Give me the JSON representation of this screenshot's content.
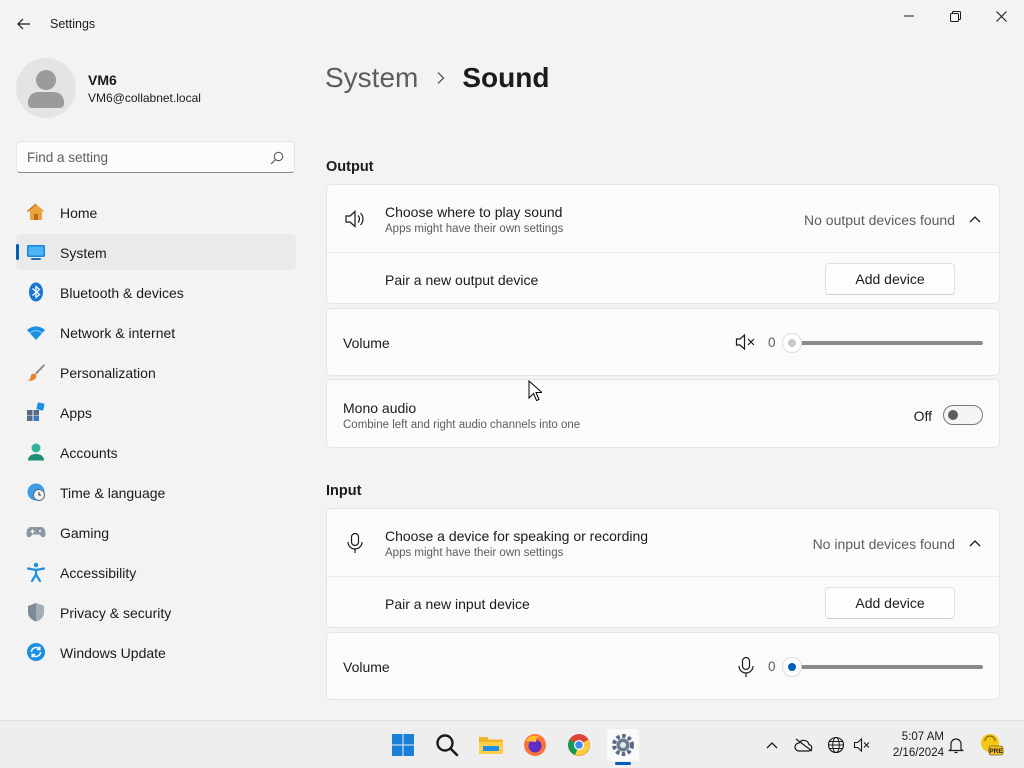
{
  "window": {
    "title": "Settings"
  },
  "profile": {
    "name": "VM6",
    "email": "VM6@collabnet.local"
  },
  "search": {
    "placeholder": "Find a setting"
  },
  "nav": {
    "items": [
      {
        "label": "Home",
        "icon": "home-icon"
      },
      {
        "label": "System",
        "icon": "system-icon",
        "active": true
      },
      {
        "label": "Bluetooth & devices",
        "icon": "bluetooth-icon"
      },
      {
        "label": "Network & internet",
        "icon": "wifi-icon"
      },
      {
        "label": "Personalization",
        "icon": "brush-icon"
      },
      {
        "label": "Apps",
        "icon": "apps-icon"
      },
      {
        "label": "Accounts",
        "icon": "accounts-icon"
      },
      {
        "label": "Time & language",
        "icon": "clock-globe-icon"
      },
      {
        "label": "Gaming",
        "icon": "gamepad-icon"
      },
      {
        "label": "Accessibility",
        "icon": "accessibility-icon"
      },
      {
        "label": "Privacy & security",
        "icon": "shield-icon"
      },
      {
        "label": "Windows Update",
        "icon": "update-icon"
      }
    ]
  },
  "breadcrumb": {
    "parent": "System",
    "current": "Sound"
  },
  "output": {
    "section_title": "Output",
    "choose_title": "Choose where to play sound",
    "choose_sub": "Apps might have their own settings",
    "choose_status": "No output devices found",
    "pair_label": "Pair a new output device",
    "add_button": "Add device",
    "volume_label": "Volume",
    "volume_value": "0",
    "volume_level": 0,
    "mono_title": "Mono audio",
    "mono_sub": "Combine left and right audio channels into one",
    "mono_state": "Off"
  },
  "input": {
    "section_title": "Input",
    "choose_title": "Choose a device for speaking or recording",
    "choose_sub": "Apps might have their own settings",
    "choose_status": "No input devices found",
    "pair_label": "Pair a new input device",
    "add_button": "Add device",
    "volume_label": "Volume",
    "volume_value": "0",
    "volume_level": 0
  },
  "taskbar": {
    "apps": [
      "start-icon",
      "search-icon",
      "file-explorer-icon",
      "firefox-icon",
      "chrome-icon",
      "settings-icon"
    ],
    "time": "5:07 AM",
    "date": "2/16/2024",
    "badge": "PRE"
  },
  "colors": {
    "accent": "#005fb8",
    "background": "#f3f3f3",
    "card": "#fbfbfb"
  }
}
